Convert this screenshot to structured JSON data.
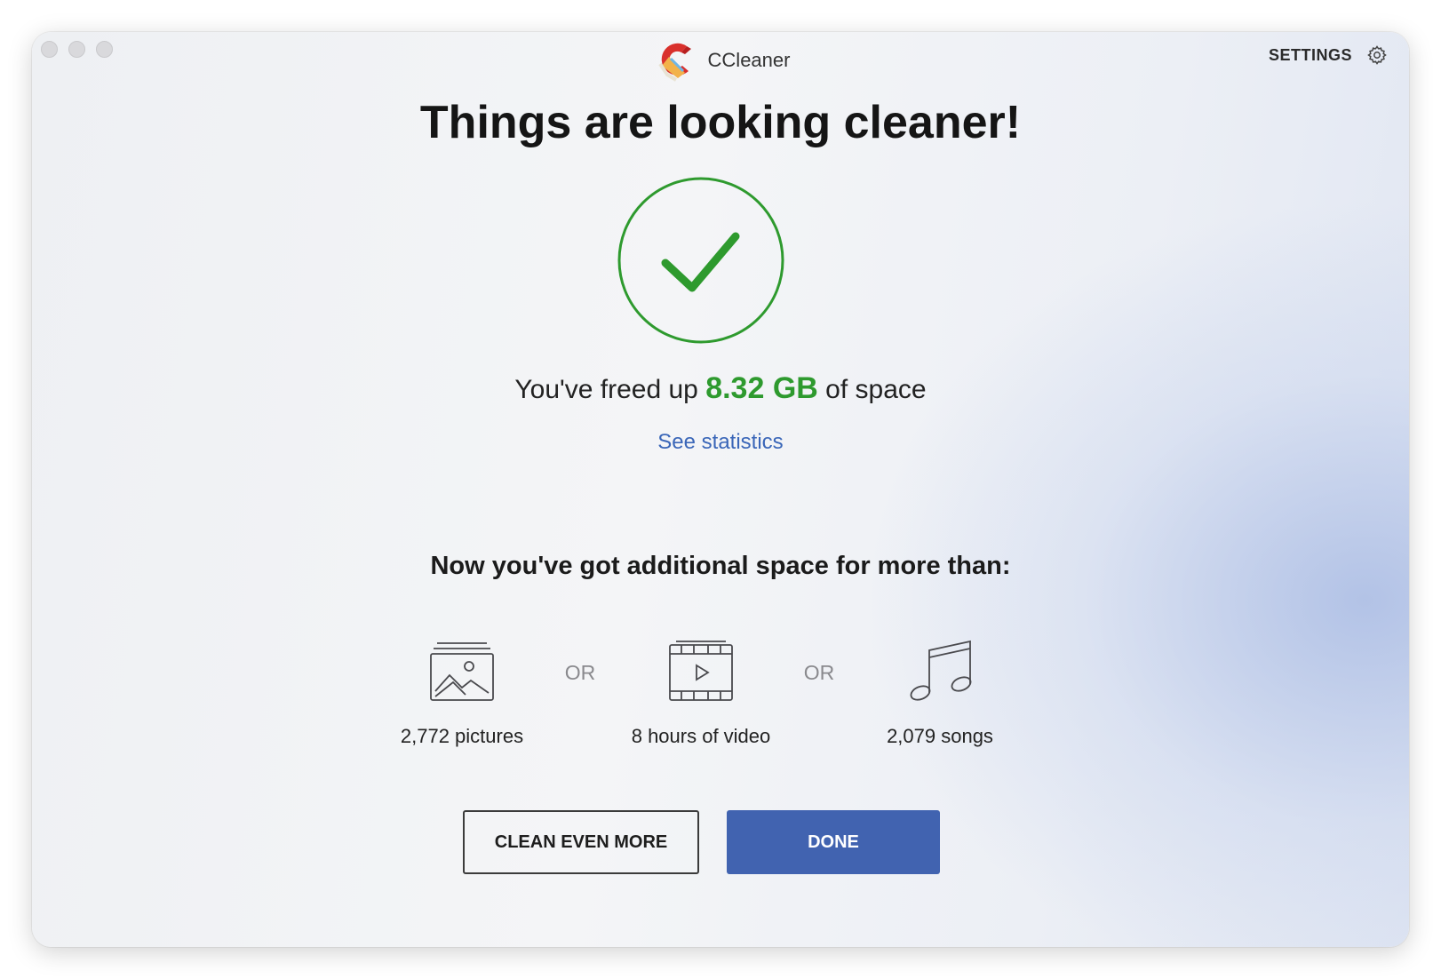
{
  "window": {
    "app_name": "CCleaner",
    "settings_label": "SETTINGS"
  },
  "main": {
    "headline": "Things are looking cleaner!",
    "freed_prefix": "You've freed up",
    "freed_amount": "8.32 GB",
    "freed_suffix": "of space",
    "stats_link": "See statistics",
    "additional_heading": "Now you've got additional space for more than:"
  },
  "equivalents": [
    {
      "icon": "picture-icon",
      "label": "2,772 pictures"
    },
    {
      "icon": "video-icon",
      "label": "8 hours of video"
    },
    {
      "icon": "music-note-icon",
      "label": "2,079 songs"
    }
  ],
  "separator": "OR",
  "buttons": {
    "secondary_label": "CLEAN EVEN MORE",
    "primary_label": "DONE"
  },
  "colors": {
    "success_green": "#2e9a2e",
    "link_blue": "#3a66b8",
    "primary_button": "#4163b0"
  }
}
